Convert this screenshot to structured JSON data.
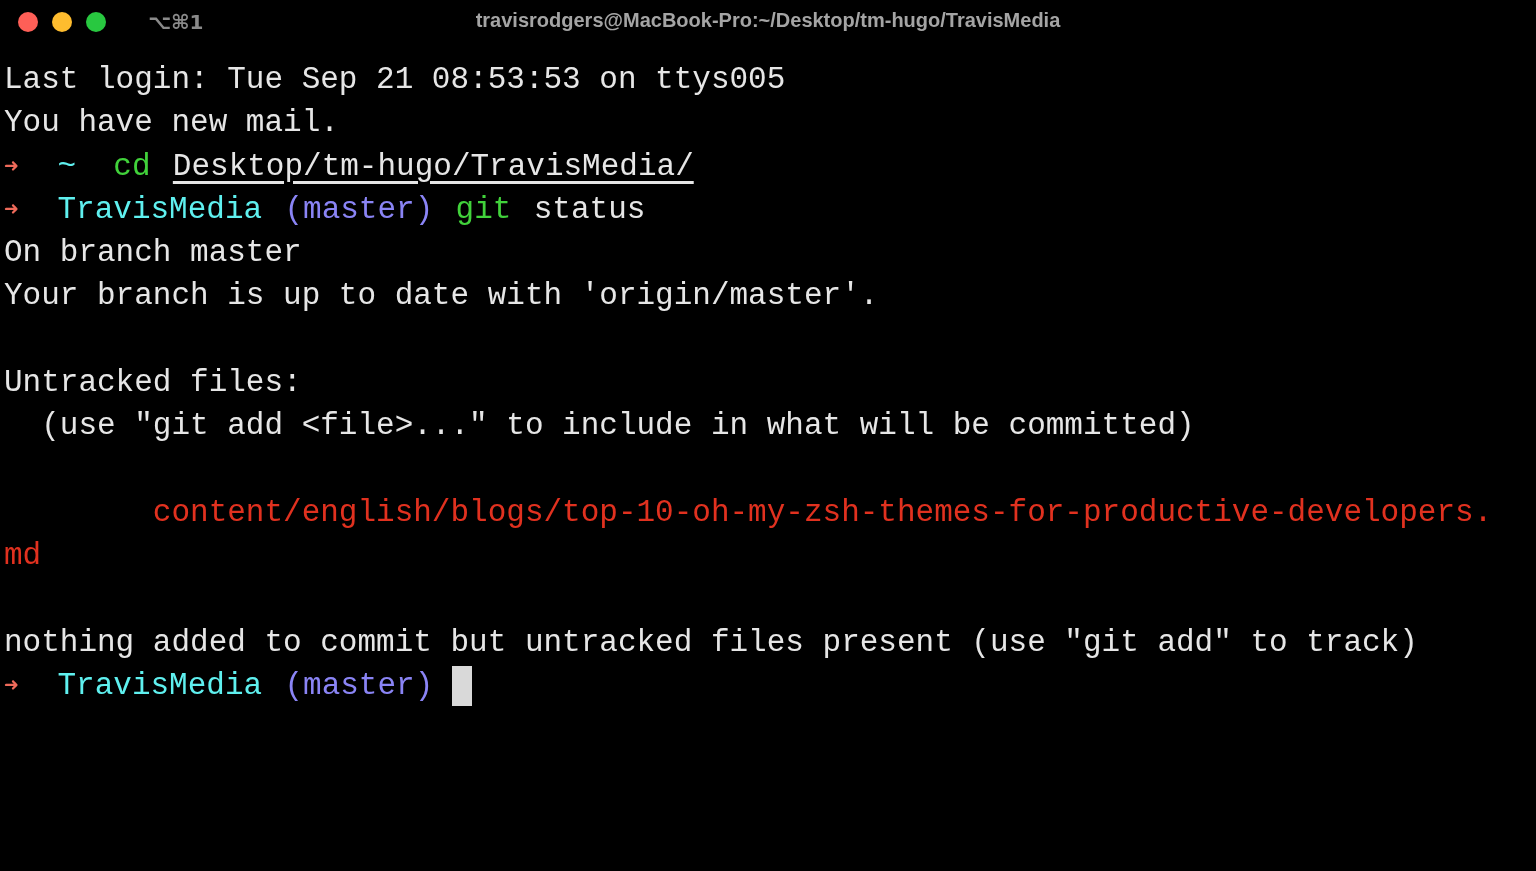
{
  "window": {
    "shortcut": "⌥⌘1",
    "title": "travisrodgers@MacBook-Pro:~/Desktop/tm-hugo/TravisMedia"
  },
  "blocks": [
    {
      "lines": [
        {
          "segments": [
            {
              "kind": "output",
              "text": "Last login: Tue Sep 21 08:53:53 on ttys005"
            }
          ]
        },
        {
          "segments": [
            {
              "kind": "output",
              "text": "You have new mail."
            }
          ]
        },
        {
          "segments": [
            {
              "kind": "arrow",
              "text": "➜"
            },
            {
              "kind": "dir",
              "text": "~"
            },
            {
              "kind": "command",
              "text": "cd"
            },
            {
              "kind": "path",
              "text": "Desktop/tm-hugo/TravisMedia/"
            }
          ]
        },
        {
          "segments": [
            {
              "kind": "arrow",
              "text": "➜"
            },
            {
              "kind": "dir",
              "text": "TravisMedia"
            },
            {
              "kind": "branch",
              "text": "(master)"
            },
            {
              "kind": "command",
              "text": "git"
            },
            {
              "kind": "output",
              "text": "status"
            }
          ]
        },
        {
          "segments": [
            {
              "kind": "output",
              "text": "On branch master"
            }
          ]
        },
        {
          "segments": [
            {
              "kind": "output",
              "text": "Your branch is up to date with 'origin/master'."
            }
          ]
        }
      ]
    },
    {
      "lines": [
        {
          "segments": [
            {
              "kind": "output",
              "text": "Untracked files:"
            }
          ]
        },
        {
          "segments": [
            {
              "kind": "output",
              "text": "  (use \"git add <file>...\" to include in what will be committed)"
            }
          ]
        }
      ]
    },
    {
      "lines": [
        {
          "segments": [
            {
              "kind": "file",
              "text": "        content/english/blogs/top-10-oh-my-zsh-themes-for-productive-developers."
            }
          ]
        },
        {
          "segments": [
            {
              "kind": "file",
              "text": "md"
            }
          ]
        }
      ]
    },
    {
      "lines": [
        {
          "segments": [
            {
              "kind": "output",
              "text": "nothing added to commit but untracked files present (use \"git add\" to track)"
            }
          ]
        },
        {
          "segments": [
            {
              "kind": "arrow",
              "text": "➜"
            },
            {
              "kind": "dir",
              "text": "TravisMedia"
            },
            {
              "kind": "branch",
              "text": "(master)"
            },
            {
              "kind": "cursor"
            }
          ]
        }
      ]
    }
  ]
}
